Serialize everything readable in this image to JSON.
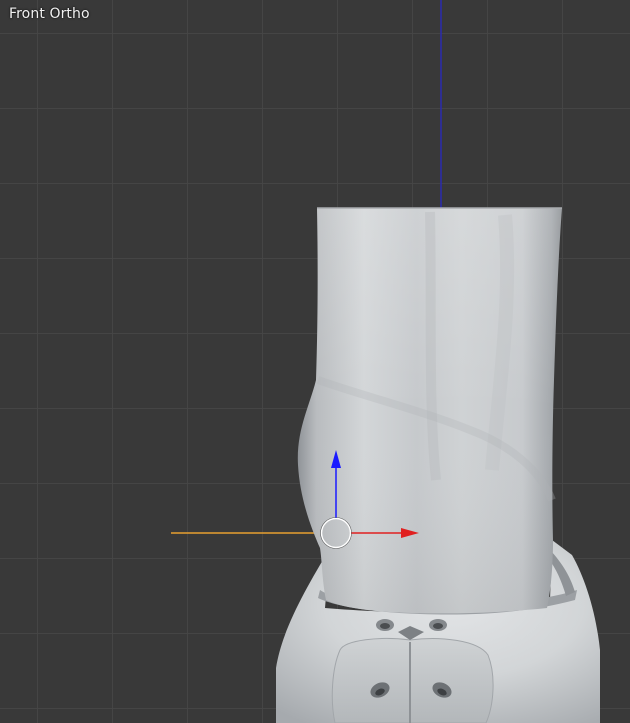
{
  "viewport": {
    "view_label": "Front Ortho"
  },
  "icons": {
    "gizmo_z": "blue-arrow-z-axis",
    "gizmo_x": "red-arrow-x-axis",
    "gizmo_center": "white-circle-pivot"
  },
  "colors": {
    "background": "#393939",
    "grid_line": "#464646",
    "z_axis_line": "#2222aa",
    "x_axis_line": "#e8a030",
    "gizmo_red": "#e02020",
    "gizmo_blue": "#1a1aff",
    "mesh_light": "#d6d9db",
    "mesh_shadow": "#8c9094"
  }
}
